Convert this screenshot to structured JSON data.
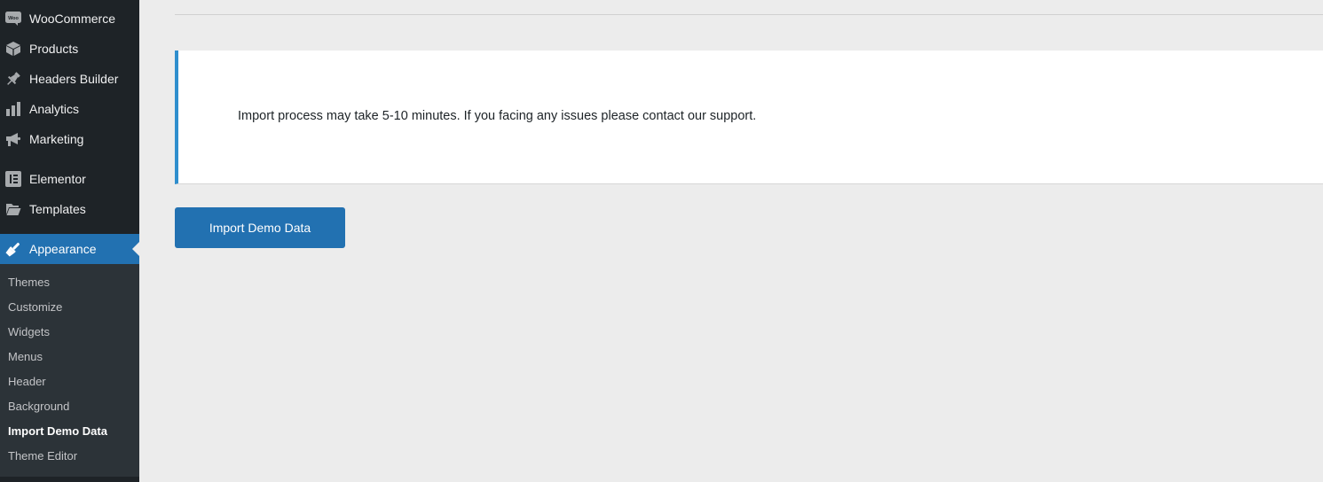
{
  "sidebar": {
    "items": [
      {
        "label": "WooCommerce",
        "icon": "woo-icon"
      },
      {
        "label": "Products",
        "icon": "box-icon"
      },
      {
        "label": "Headers Builder",
        "icon": "pin-icon"
      },
      {
        "label": "Analytics",
        "icon": "bar-chart-icon"
      },
      {
        "label": "Marketing",
        "icon": "megaphone-icon"
      },
      {
        "label": "Elementor",
        "icon": "elementor-icon"
      },
      {
        "label": "Templates",
        "icon": "folder-icon"
      },
      {
        "label": "Appearance",
        "icon": "brush-icon",
        "active": true
      }
    ],
    "woo_badge": "Woo",
    "submenu": [
      {
        "label": "Themes"
      },
      {
        "label": "Customize"
      },
      {
        "label": "Widgets"
      },
      {
        "label": "Menus"
      },
      {
        "label": "Header"
      },
      {
        "label": "Background"
      },
      {
        "label": "Import Demo Data",
        "current": true
      },
      {
        "label": "Theme Editor"
      }
    ]
  },
  "notice": {
    "text": "Import process may take 5-10 minutes. If you facing any issues please contact our support."
  },
  "actions": {
    "import_button_label": "Import Demo Data"
  },
  "colors": {
    "accent": "#2271b1",
    "sidebar_bg": "#1e2327",
    "submenu_bg": "#2c3338",
    "notice_border": "#2f8ecd",
    "page_bg": "#ececec"
  }
}
